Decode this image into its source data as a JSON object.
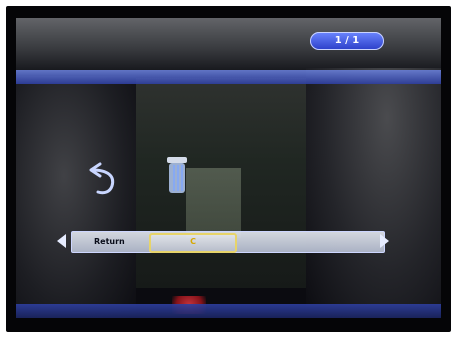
{
  "osd": {
    "page_indicator": "1 / 1",
    "option_label": "Return",
    "option_value": "C"
  },
  "colors": {
    "accent_blue": "#2b3ec8",
    "selection_border": "#e7d46a",
    "value_text": "#d7a800",
    "option_row_bg": "#c8cfdf"
  },
  "icons": {
    "return": "return-arrow-icon",
    "trash": "trash-bin-icon",
    "left": "left-arrow-icon",
    "right": "right-arrow-icon"
  }
}
